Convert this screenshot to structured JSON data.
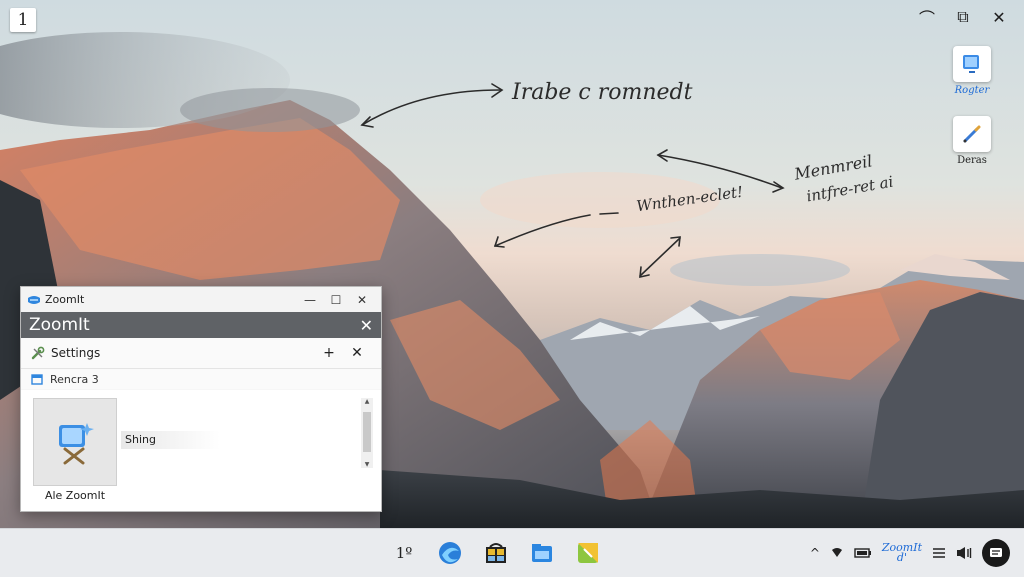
{
  "desktop": {
    "corner_label": "1",
    "icons": [
      {
        "label": "Rogter"
      },
      {
        "label": "Deras"
      }
    ],
    "annotations": [
      {
        "text": "Irabe c romnedt"
      },
      {
        "text": "Wnthen-eclet!"
      },
      {
        "text": "Menmreil"
      },
      {
        "text": "intfre-ret ai"
      }
    ]
  },
  "window_controls": {
    "minimize": "⌒",
    "maximize": "⧉",
    "close": "✕"
  },
  "zoomit_window": {
    "title": "ZoomIt",
    "header": "ZoomIt",
    "settings_label": "Settings",
    "add_symbol": "+",
    "close_symbol": "✕",
    "row_label": "Rencra 3",
    "tool_label": "Ale ZoomIt",
    "field_value": "Shing",
    "title_controls": {
      "minimize": "—",
      "maximize": "☐",
      "close": "✕"
    }
  },
  "taskbar": {
    "first_app_label": "1º",
    "tray": {
      "chevron": "^",
      "zoomit_label": "ZoomIt",
      "zoomit_sub": "d'"
    }
  },
  "colors": {
    "accent": "#1d6ad6",
    "window_header": "#5f6266",
    "taskbar": "#e9ebee"
  }
}
